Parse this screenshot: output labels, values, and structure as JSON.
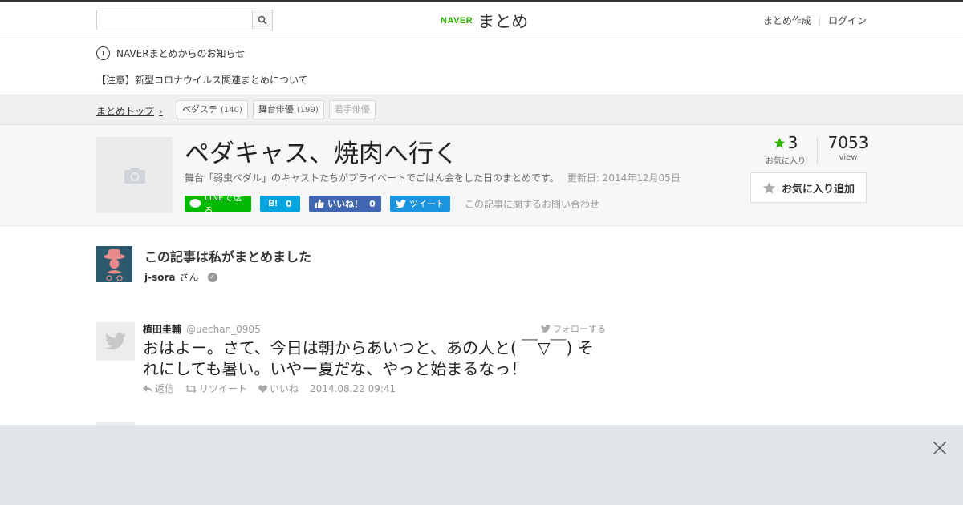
{
  "header": {
    "search_placeholder": "",
    "logo_naver": "NAVER",
    "logo_matome": "まとめ",
    "create_link": "まとめ作成",
    "login_link": "ログイン"
  },
  "notice": {
    "icon_glyph": "i",
    "title": "NAVERまとめからのお知らせ",
    "link": "【注意】新型コロナウイルス関連まとめについて"
  },
  "breadcrumb": {
    "top": "まとめトップ",
    "arrow": "›",
    "tags": [
      {
        "label": "ペダステ",
        "count": "(140)"
      },
      {
        "label": "舞台俳優",
        "count": "(199)"
      },
      {
        "label": "若手俳優",
        "count": ""
      }
    ]
  },
  "article": {
    "title": "ペダキャス、焼肉へ行く",
    "description": "舞台「弱虫ペダル」のキャストたちがプライベートでごはん会をした日のまとめです。",
    "updated": "更新日: 2014年12月05日",
    "share": {
      "line": "LINEで送る",
      "hatena_icon": "B!",
      "hatena_count": "0",
      "fb_like": "いいね！",
      "fb_count": "0",
      "tweet": "ツイート"
    },
    "contact": "この記事に関するお問い合わせ",
    "fav_count": "3",
    "fav_label": "お気に入り",
    "view_count": "7053",
    "view_label": "view",
    "fav_button": "お気に入り追加"
  },
  "author": {
    "heading": "この記事は私がまとめました",
    "name": "j-sora",
    "suffix": "さん",
    "verified_glyph": "✓"
  },
  "tweets": [
    {
      "name": "植田圭輔",
      "handle": "@uechan_0905",
      "follow": "フォローする",
      "text": "おはよー。さて、今日は朝からあいつと、あの人と( ￣▽￣) それにしても暑い。いやー夏だな、やっと始まるなっ！",
      "reply": "返信",
      "retweet": "リツイート",
      "like": "いいね",
      "date": "2014.08.22 09:41"
    }
  ],
  "colors": {
    "naver_green": "#2db400",
    "line_green": "#00b900",
    "hatena_blue": "#00a4de",
    "fb_blue": "#4267b2",
    "twitter_blue": "#1b95e0",
    "star_green": "#2db400",
    "overlay_gray": "#e1e4e7"
  },
  "icons": [
    "search-icon",
    "info-icon",
    "camera-icon",
    "star-icon",
    "twitter-bird-icon",
    "reply-icon",
    "retweet-icon",
    "heart-icon",
    "close-icon"
  ]
}
